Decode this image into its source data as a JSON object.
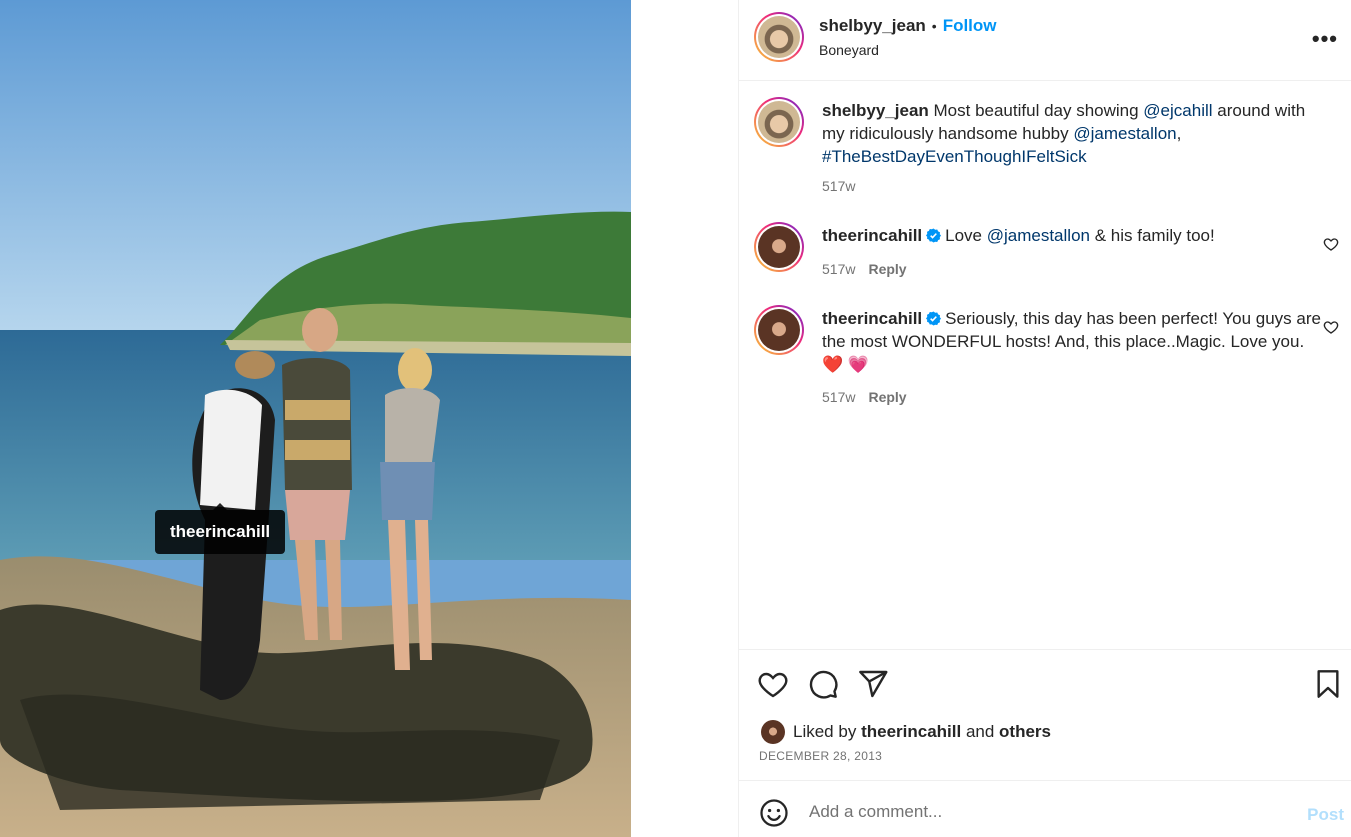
{
  "photo": {
    "tag_label": "theerincahill"
  },
  "header": {
    "username": "shelbyy_jean",
    "separator": "•",
    "follow_label": "Follow",
    "location": "Boneyard",
    "more_icon": "more-options-icon"
  },
  "caption": {
    "username": "shelbyy_jean",
    "text_1": " Most beautiful day showing ",
    "mention_1": "@ejcahill",
    "text_2": " around with my ridiculously handsome hubby ",
    "mention_2": "@jamestallon",
    "text_3": ", ",
    "hashtag": "#TheBestDayEvenThoughIFeltSick",
    "time": "517w"
  },
  "comments": [
    {
      "username": "theerincahill",
      "text_1": "Love ",
      "mention": "@jamestallon",
      "text_2": " & his family too!",
      "time": "517w",
      "reply_label": "Reply"
    },
    {
      "username": "theerincahill",
      "text": "Seriously, this day has been perfect! You guys are the most WONDERFUL hosts! And, this place..Magic. Love you. ",
      "emoji": "❤️ 💗",
      "time": "517w",
      "reply_label": "Reply"
    }
  ],
  "actions": {
    "liked_prefix": "Liked by ",
    "liked_user": "theerincahill",
    "liked_and": " and ",
    "liked_others": "others",
    "date": "DECEMBER 28, 2013"
  },
  "add_comment": {
    "placeholder": "Add a comment...",
    "post_label": "Post"
  },
  "colors": {
    "follow": "#0095f6",
    "link": "#00376b",
    "verified": "#0095f6",
    "post_disabled": "#b2dffc"
  }
}
